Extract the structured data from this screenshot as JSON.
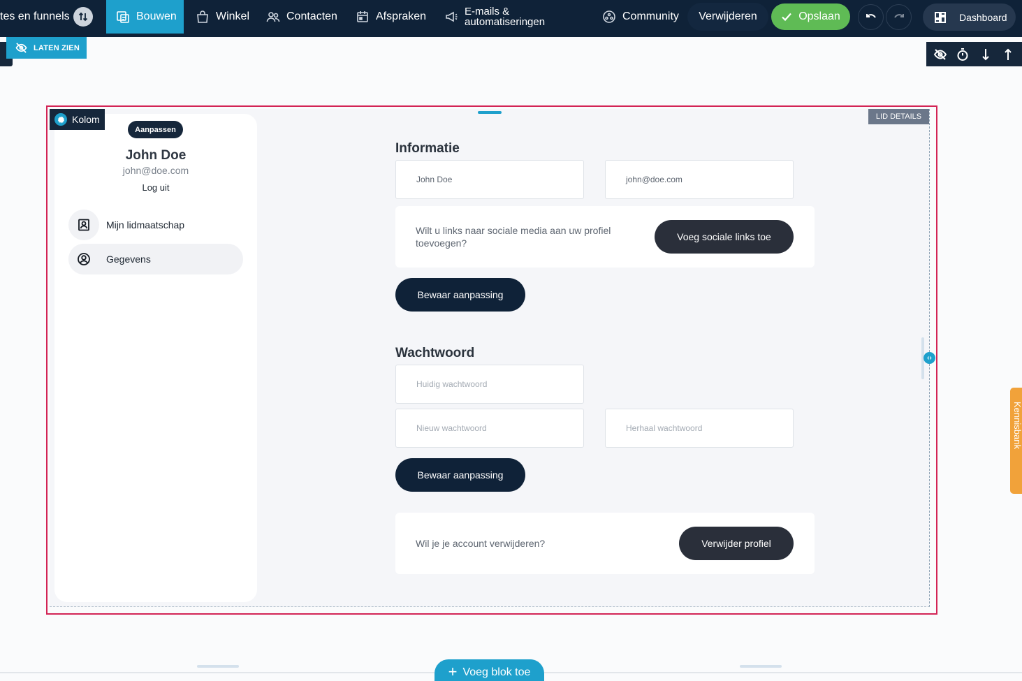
{
  "topbar": {
    "funnels_label": "tes en funnels",
    "tabs": [
      {
        "label": "Bouwen",
        "icon": "builder-icon",
        "active": true
      },
      {
        "label": "Winkel",
        "icon": "shopping-bag-icon"
      },
      {
        "label": "Contacten",
        "icon": "contacts-icon"
      },
      {
        "label": "Afspraken",
        "icon": "calendar-icon"
      },
      {
        "label": "E-mails &",
        "label_line2": "automatiseringen",
        "icon": "megaphone-icon"
      },
      {
        "label": "Community",
        "icon": "community-icon"
      }
    ],
    "delete_label": "Verwijderen",
    "save_label": "Opslaan",
    "dashboard_label": "Dashboard"
  },
  "toolbar": {
    "show_label": "LATEN ZIEN"
  },
  "section": {
    "tag": "LID DETAILS",
    "column_label": "Kolom",
    "colors": {
      "frame": "#d32455",
      "accent": "#1ea0cc",
      "navy": "#0f2238"
    }
  },
  "profile": {
    "edit_badge": "Aanpassen",
    "name": "John Doe",
    "email": "john@doe.com",
    "logout": "Log uit",
    "menu": [
      {
        "label": "Mijn lidmaatschap",
        "icon": "member-card-icon"
      },
      {
        "label": "Gegevens",
        "icon": "user-circle-icon",
        "active": true
      }
    ]
  },
  "info": {
    "heading": "Informatie",
    "name_value": "John Doe",
    "email_value": "john@doe.com",
    "social_prompt": "Wilt u links naar sociale media aan uw profiel toevoegen?",
    "social_button": "Voeg sociale links toe",
    "save_button": "Bewaar aanpassing"
  },
  "password": {
    "heading": "Wachtwoord",
    "current_placeholder": "Huidig wachtwoord",
    "new_placeholder": "Nieuw wachtwoord",
    "repeat_placeholder": "Herhaal wachtwoord",
    "save_button": "Bewaar aanpassing"
  },
  "delete_account": {
    "prompt": "Wil je je account verwijderen?",
    "button": "Verwijder profiel"
  },
  "bottom": {
    "add_block_label": "Voeg blok toe"
  },
  "side_tab": {
    "label": "Kennisbank"
  }
}
